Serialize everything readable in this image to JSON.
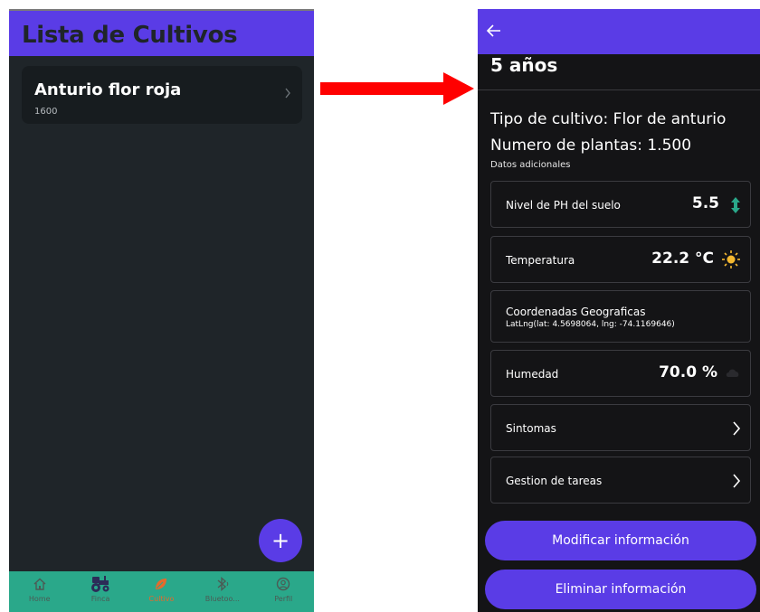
{
  "left_screen": {
    "title": "Lista de Cultivos",
    "crop_card": {
      "name": "Anturio flor roja",
      "subtitle": "1600"
    },
    "fab_label": "+",
    "bottom_nav": [
      {
        "label": "Home",
        "icon": "home-icon"
      },
      {
        "label": "Finca",
        "icon": "tractor-icon"
      },
      {
        "label": "Cultivo",
        "icon": "leaf-icon",
        "active": true
      },
      {
        "label": "Bluetoo...",
        "icon": "bluetooth-icon"
      },
      {
        "label": "Perfil",
        "icon": "profile-icon"
      }
    ]
  },
  "right_screen": {
    "header_years": "5 años",
    "crop_type": "Tipo de cultivo: Flor de anturio",
    "plant_count": "Numero de plantas:  1.500",
    "extra_label": "Datos adicionales",
    "ph": {
      "label": "Nivel de PH del suelo",
      "value": "5.5",
      "icon": "updown-arrow-icon"
    },
    "temperature": {
      "label": "Temperatura",
      "value": "22.2 °C",
      "icon": "sun-icon"
    },
    "coordinates": {
      "label": "Coordenadas Geograficas",
      "value": "LatLng(lat: 4.5698064, lng: -74.1169646)"
    },
    "humidity": {
      "label": "Humedad",
      "value": "70.0 %",
      "icon": "cloud-icon"
    },
    "symptoms": {
      "label": "Sintomas"
    },
    "tasks": {
      "label": "Gestion de tareas"
    },
    "buttons": {
      "modify": "Modificar información",
      "delete": "Eliminar información"
    }
  },
  "colors": {
    "appbar": "#5a3ce6",
    "left_bg": "#1f2529",
    "right_bg": "#141416",
    "nav_bg": "#2aa88a",
    "active_nav": "#e56a2c",
    "arrow": "#ff0000"
  }
}
